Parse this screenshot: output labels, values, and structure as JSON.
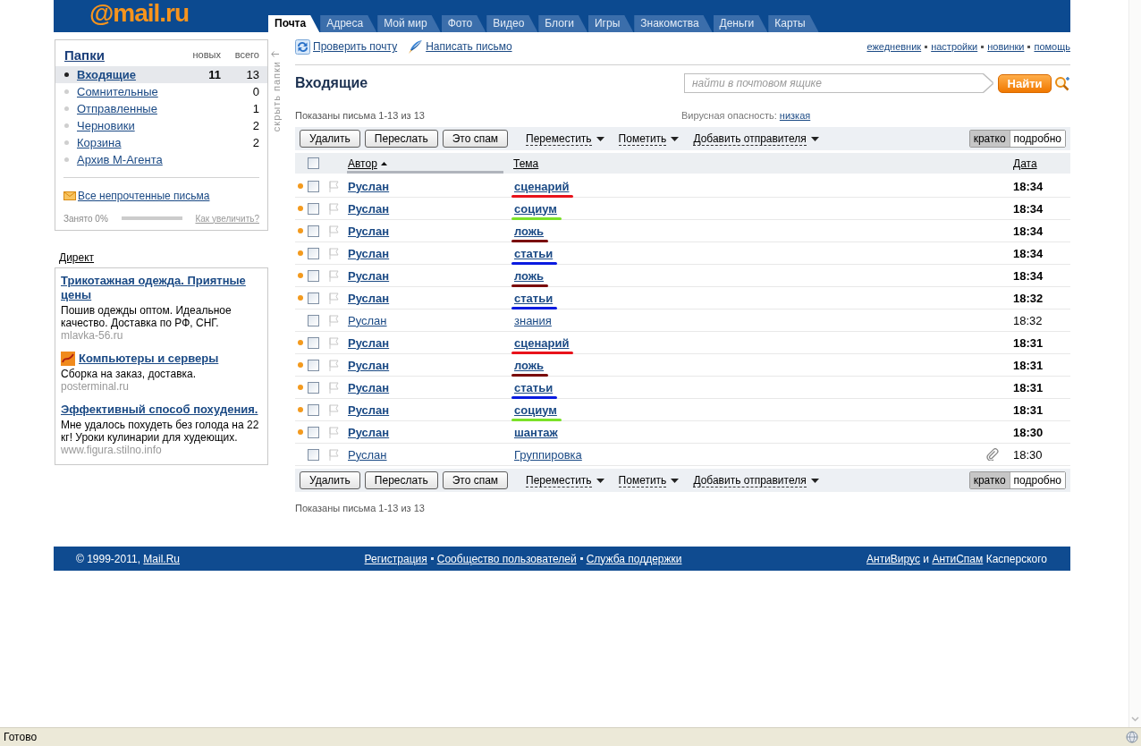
{
  "header": {
    "logo": "@mail.ru",
    "tabs": [
      {
        "label": "Почта",
        "selected": true
      },
      {
        "label": "Адреса",
        "selected": false
      },
      {
        "label": "Мой мир",
        "selected": false
      },
      {
        "label": "Фото",
        "selected": false
      },
      {
        "label": "Видео",
        "selected": false
      },
      {
        "label": "Блоги",
        "selected": false
      },
      {
        "label": "Игры",
        "selected": false
      },
      {
        "label": "Знакомства",
        "selected": false
      },
      {
        "label": "Деньги",
        "selected": false
      },
      {
        "label": "Карты",
        "selected": false
      }
    ]
  },
  "sidebar": {
    "folders": {
      "title": "Папки",
      "new_heading": "новых",
      "total_heading": "всего",
      "items": [
        {
          "name": "Входящие",
          "new": "11",
          "total": "13",
          "selected": true
        },
        {
          "name": "Сомнительные",
          "total": "0",
          "selected": false
        },
        {
          "name": "Отправленные",
          "total": "1",
          "selected": false
        },
        {
          "name": "Черновики",
          "total": "2",
          "selected": false
        },
        {
          "name": "Корзина",
          "total": "2",
          "selected": false
        },
        {
          "name": "Архив М-Агента",
          "selected": false
        }
      ],
      "unread_link": "Все непрочтенные письма",
      "quota": {
        "label": "Занято 0%",
        "level": 0,
        "link": "Как увеличить?"
      }
    },
    "hide_link": "скрыть папки",
    "direct": {
      "title": "Директ",
      "ads": [
        {
          "title": "Трикотажная одежда. Приятные цены",
          "text": "Пошив одежды оптом. Идеальное качество. Доставка по РФ, СНГ.",
          "site": "mlavka-56.ru",
          "logo": false
        },
        {
          "title": "Компьютеры и серверы",
          "text": "Сборка на заказ, доставка.",
          "site": "posterminal.ru",
          "logo": true
        },
        {
          "title": "Эффективный способ похудения.",
          "text": "Мне удалось похудеть без голода на 22 кг! Уроки кулинарии для худеющих.",
          "site": "www.figura.stilno.info",
          "logo": false
        }
      ]
    }
  },
  "mail": {
    "actions": [
      {
        "label": "Проверить почту",
        "kind": "check"
      },
      {
        "label": "Написать письмо",
        "kind": "compose"
      }
    ],
    "links": [
      "ежедневник",
      "настройки",
      "новинки",
      "помощь"
    ],
    "title": "Входящие",
    "search": {
      "placeholder": "найти в почтовом ящике",
      "button": "Найти"
    },
    "summary": "Показаны письма 1-13 из 13",
    "virus": {
      "label": "Вирусная опасность:",
      "link": "низкая"
    },
    "toolbar_top": {
      "buttons": [
        "Удалить",
        "Переслать",
        "Это спам"
      ],
      "menus": [
        "Переместить",
        "Пометить",
        "Добавить отправителя"
      ],
      "views": [
        {
          "label": "кратко",
          "selected": true
        },
        {
          "label": "подробно",
          "selected": false
        }
      ]
    },
    "table": {
      "select_all": {
        "checked": false
      },
      "columns": [
        {
          "label": "Автор",
          "sorted": true
        },
        {
          "label": "Тема",
          "sorted": false
        },
        {
          "label": "Дата",
          "sorted": false
        }
      ],
      "rows": [
        {
          "author": "Руслан",
          "subject": "сценарий",
          "time": "18:34",
          "unread": true,
          "checked": false,
          "flagged": false,
          "attachment": false,
          "color": "#e8131b"
        },
        {
          "author": "Руслан",
          "subject": "социум",
          "time": "18:34",
          "unread": true,
          "checked": false,
          "flagged": false,
          "attachment": false,
          "color": "#7be128"
        },
        {
          "author": "Руслан",
          "subject": "ложь",
          "time": "18:34",
          "unread": true,
          "checked": false,
          "flagged": false,
          "attachment": false,
          "color": "#7a0a0a"
        },
        {
          "author": "Руслан",
          "subject": "статьи",
          "time": "18:34",
          "unread": true,
          "checked": false,
          "flagged": false,
          "attachment": false,
          "color": "#0a1be0"
        },
        {
          "author": "Руслан",
          "subject": "ложь",
          "time": "18:34",
          "unread": true,
          "checked": false,
          "flagged": false,
          "attachment": false,
          "color": "#7a0a0a"
        },
        {
          "author": "Руслан",
          "subject": "статьи",
          "time": "18:32",
          "unread": true,
          "checked": false,
          "flagged": false,
          "attachment": false,
          "color": "#0a1be0"
        },
        {
          "author": "Руслан",
          "subject": "знания",
          "time": "18:32",
          "unread": false,
          "checked": false,
          "flagged": false,
          "attachment": false
        },
        {
          "author": "Руслан",
          "subject": "сценарий",
          "time": "18:31",
          "unread": true,
          "checked": false,
          "flagged": false,
          "attachment": false,
          "color": "#e8131b"
        },
        {
          "author": "Руслан",
          "subject": "ложь",
          "time": "18:31",
          "unread": true,
          "checked": false,
          "flagged": false,
          "attachment": false,
          "color": "#7a0a0a"
        },
        {
          "author": "Руслан",
          "subject": "статьи",
          "time": "18:31",
          "unread": true,
          "checked": false,
          "flagged": false,
          "attachment": false,
          "color": "#0a1be0"
        },
        {
          "author": "Руслан",
          "subject": "социум",
          "time": "18:31",
          "unread": true,
          "checked": false,
          "flagged": false,
          "attachment": false,
          "color": "#7be128"
        },
        {
          "author": "Руслан",
          "subject": "шантаж",
          "time": "18:30",
          "unread": true,
          "checked": false,
          "flagged": false,
          "attachment": false
        },
        {
          "author": "Руслан",
          "subject": "Группировка",
          "time": "18:30",
          "unread": false,
          "checked": false,
          "flagged": false,
          "attachment": true
        }
      ]
    },
    "toolbar_bottom": {
      "buttons": [
        "Удалить",
        "Переслать",
        "Это спам"
      ],
      "menus": [
        "Переместить",
        "Пометить",
        "Добавить отправителя"
      ],
      "views": [
        {
          "label": "кратко",
          "selected": true
        },
        {
          "label": "подробно",
          "selected": false
        }
      ]
    },
    "summary_bottom": "Показаны письма 1-13 из 13"
  },
  "footer": {
    "copyright": "© 1999-2011,",
    "copyright_link": "Mail.Ru",
    "links": [
      "Регистрация",
      "Сообщество пользователей",
      "Служба поддержки"
    ],
    "credit": {
      "antivirus_link": "АнтиВирус",
      "joiner": "и",
      "antispam_link": "АнтиСпам",
      "suffix": "Касперского"
    }
  },
  "status_bar": {
    "text": "Готово"
  }
}
